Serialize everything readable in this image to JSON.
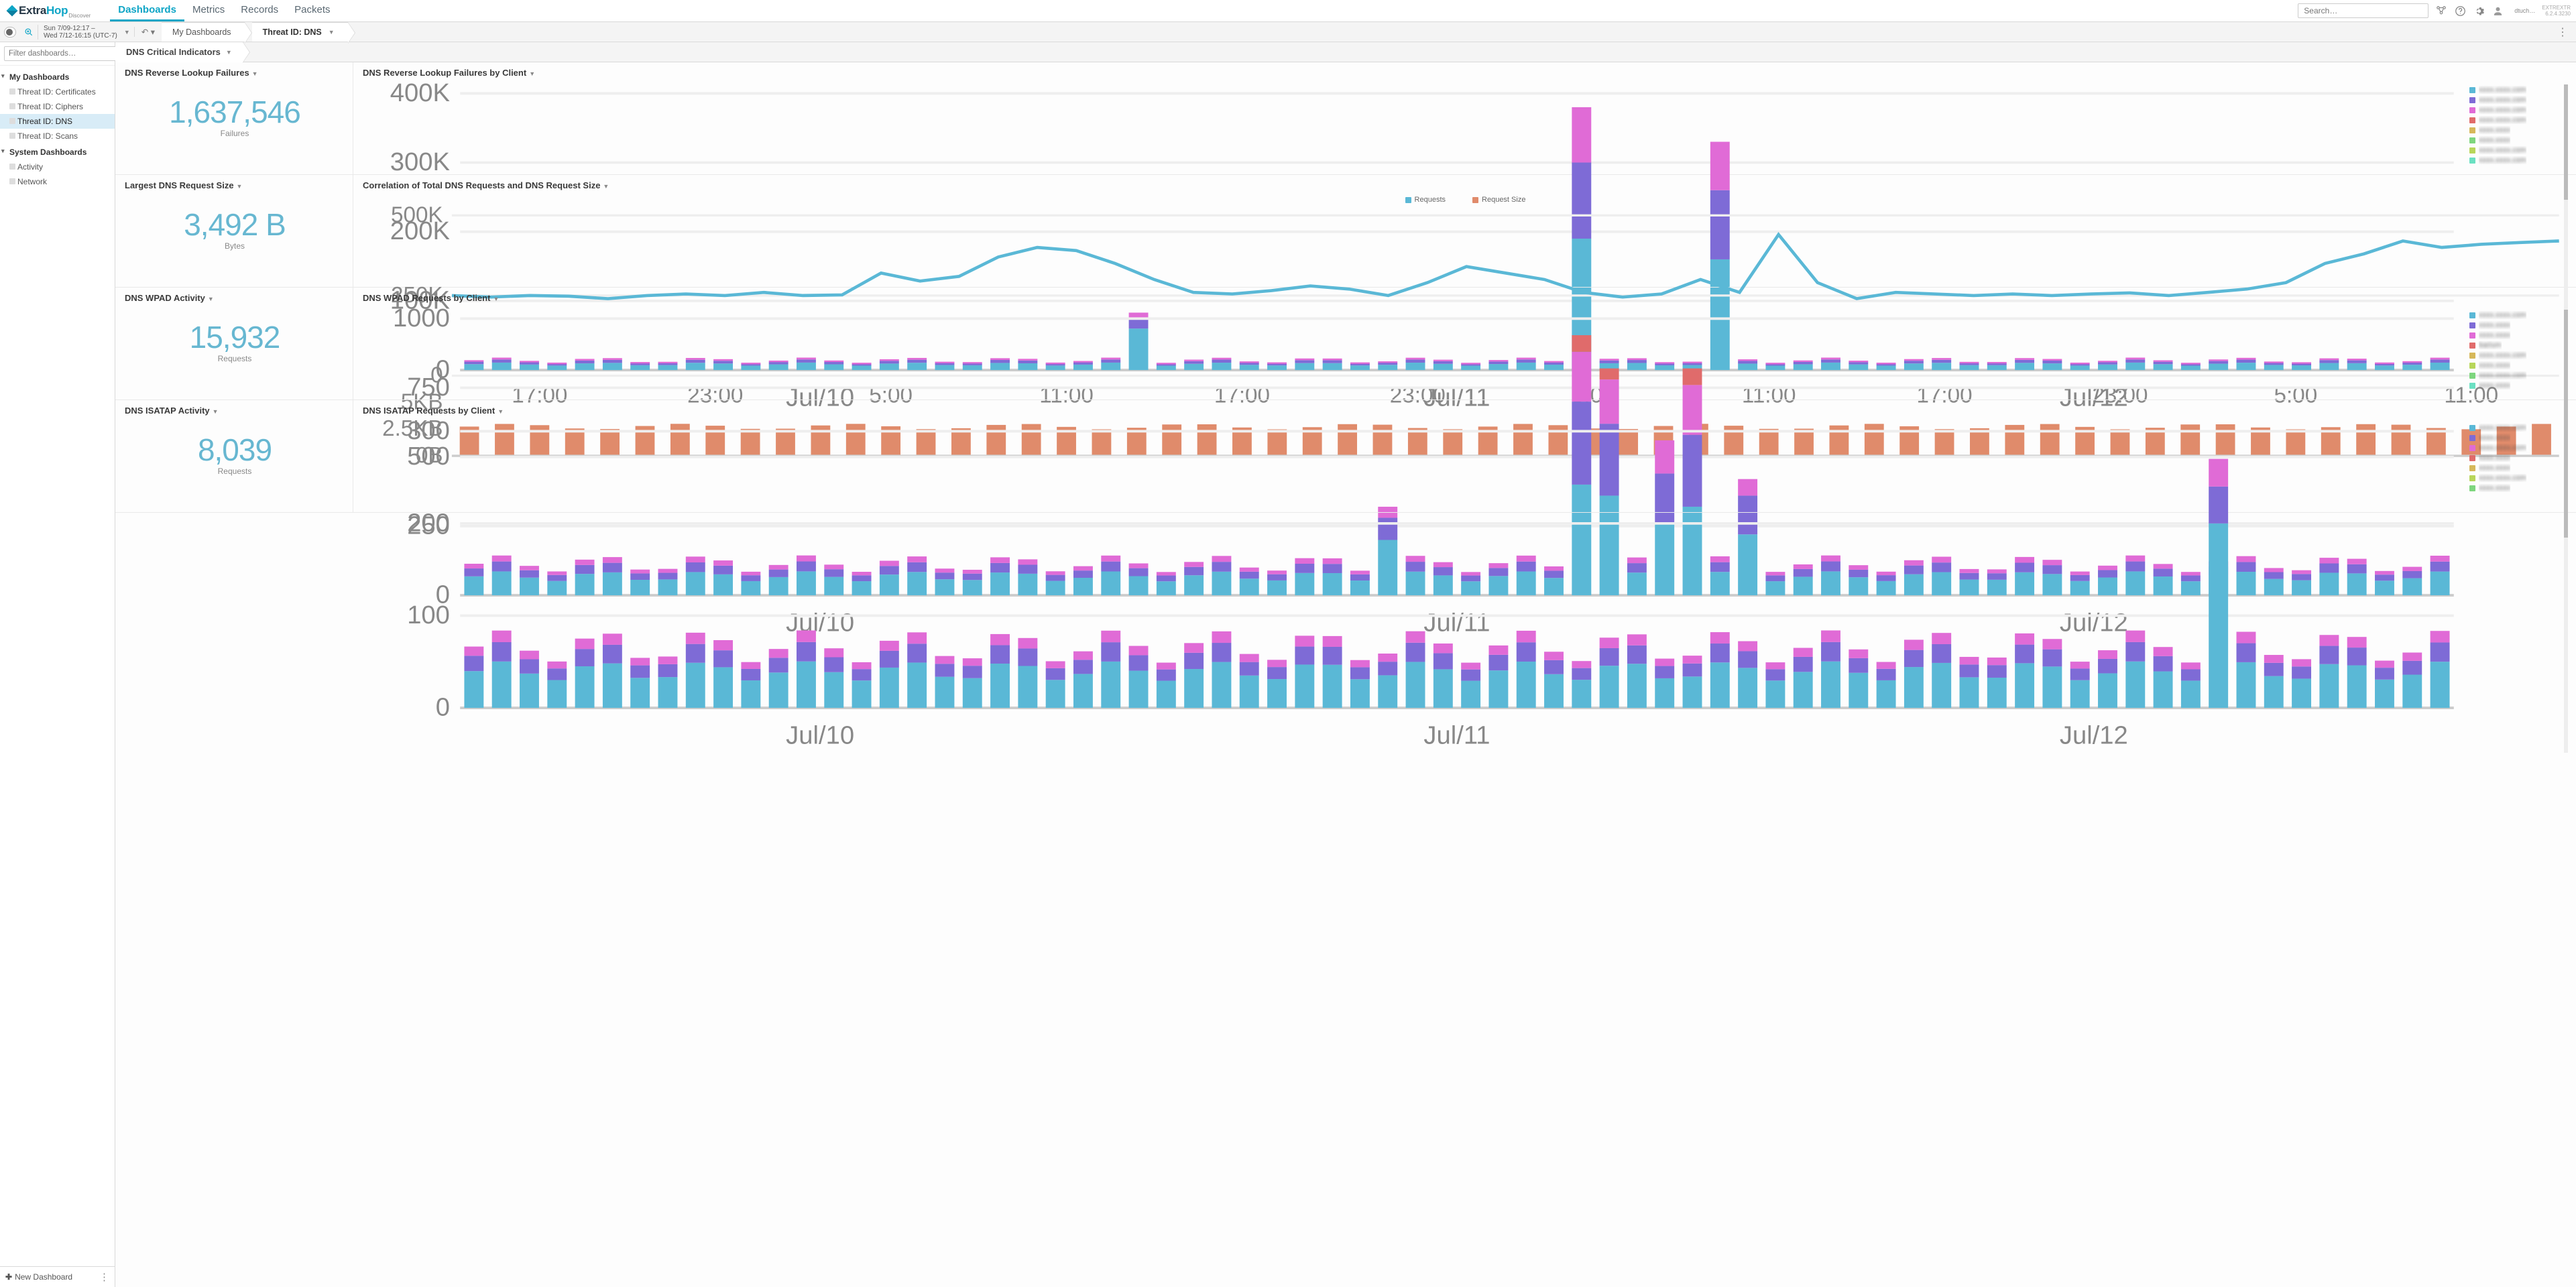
{
  "header": {
    "brand_prefix": "Extra",
    "brand_suffix": "Hop",
    "brand_sub": "Discover",
    "nav": [
      "Dashboards",
      "Metrics",
      "Records",
      "Packets"
    ],
    "nav_active": 0,
    "search_placeholder": "Search…",
    "username": "dtuch…",
    "product": "EXTREXTR",
    "version": "6.2.4.3230"
  },
  "secbar": {
    "time_line1": "Sun 7/09-12:17 –",
    "time_line2": "Wed 7/12-16:15 (UTC-7)",
    "crumb1": "My Dashboards",
    "crumb2": "Threat ID: DNS"
  },
  "sidebar": {
    "filter_placeholder": "Filter dashboards…",
    "groups": [
      {
        "label": "My Dashboards",
        "items": [
          "Threat ID: Certificates",
          "Threat ID: Ciphers",
          "Threat ID: DNS",
          "Threat ID: Scans"
        ],
        "active_index": 2
      },
      {
        "label": "System Dashboards",
        "items": [
          "Activity",
          "Network"
        ],
        "active_index": -1
      }
    ],
    "new_dashboard": "New Dashboard"
  },
  "region_title": "DNS Critical Indicators",
  "stats": [
    {
      "title": "DNS Reverse Lookup Failures",
      "value": "1,637,546",
      "unit": "Failures"
    },
    {
      "title": "Largest DNS Request Size",
      "value": "3,492 B",
      "unit": "Bytes"
    },
    {
      "title": "DNS WPAD Activity",
      "value": "15,932",
      "unit": "Requests"
    },
    {
      "title": "DNS ISATAP Activity",
      "value": "8,039",
      "unit": "Requests"
    }
  ],
  "charts": {
    "reverse_lookup": {
      "title": "DNS Reverse Lookup Failures by Client",
      "legend": [
        "xxxx.xxxx.com",
        "xxxx.xxxx.com",
        "xxxx.xxxx.com",
        "xxxx.xxxx.com",
        "xxxx.xxxx",
        "xxxx.xxxx",
        "xxxx.xxxx.com",
        "xxxx.xxxx.com"
      ]
    },
    "correlation": {
      "title": "Correlation of Total DNS Requests and DNS Request Size",
      "legend": [
        "Requests",
        "Request Size"
      ]
    },
    "wpad": {
      "title": "DNS WPAD Requests by Client",
      "legend": [
        "xxxx.xxxx.com",
        "xxxx.xxxx",
        "xxxx.xxxx",
        "barium",
        "xxxx.xxxx.com",
        "xxxx.xxxx",
        "xxxx.xxxx.com",
        "xxxx.xxxx"
      ]
    },
    "isatap": {
      "title": "DNS ISATAP Requests by Client",
      "legend": [
        "xxxx.xxxx.com",
        "xxxx.xxxx",
        "xxxx.xxxx.com",
        "xxxx.xxxx",
        "xxxx.xxxx",
        "xxxx.xxxx.com",
        "xxxx.xxxx"
      ]
    }
  },
  "chart_data": [
    {
      "id": "reverse_lookup",
      "type": "bar",
      "stacked": true,
      "title": "DNS Reverse Lookup Failures by Client",
      "ylabel": "",
      "ylim": [
        0,
        400000
      ],
      "yticks": [
        0,
        100000,
        200000,
        300000,
        400000
      ],
      "ytick_labels": [
        "0",
        "100K",
        "200K",
        "300K",
        "400K"
      ],
      "x_major": [
        "Jul/10",
        "Jul/11",
        "Jul/12"
      ],
      "n_bars": 72,
      "colors": [
        "#5ab8d6",
        "#7e6bd6",
        "#e06bd6",
        "#e06b6b",
        "#d6b85a",
        "#7ed67e",
        "#b8d65a",
        "#6be0c2"
      ],
      "baseline": 15000,
      "spikes": [
        {
          "i": 24,
          "stack": [
            60000,
            15000,
            8000
          ]
        },
        {
          "i": 40,
          "stack": [
            190000,
            110000,
            80000
          ]
        },
        {
          "i": 45,
          "stack": [
            160000,
            100000,
            70000
          ]
        }
      ]
    },
    {
      "id": "correlation",
      "type": "line+bar",
      "title": "Correlation of Total DNS Requests and DNS Request Size",
      "top_ylim": [
        0,
        500000
      ],
      "top_yticks": [
        0,
        250000,
        500000
      ],
      "top_ytick_labels": [
        "0",
        "250K",
        "500K"
      ],
      "bottom_ylim": [
        0,
        5120
      ],
      "bottom_yticks": [
        0,
        2560,
        5120
      ],
      "bottom_ytick_labels": [
        "0B",
        "2.5KB",
        "5KB"
      ],
      "xticks": [
        "17:00",
        "23:00",
        "5:00",
        "11:00",
        "17:00",
        "23:00",
        "5:00",
        "11:00",
        "17:00",
        "23:00",
        "5:00",
        "11:00"
      ],
      "line_color": "#5ab8d6",
      "bar_color": "#e08b6b",
      "line": [
        250,
        245,
        250,
        248,
        240,
        250,
        255,
        250,
        260,
        250,
        252,
        320,
        295,
        310,
        370,
        400,
        390,
        350,
        300,
        260,
        255,
        265,
        280,
        270,
        250,
        290,
        340,
        320,
        300,
        260,
        245,
        255,
        300,
        260,
        440,
        290,
        240,
        260,
        255,
        250,
        255,
        250,
        255,
        258,
        250,
        260,
        270,
        290,
        350,
        380,
        420,
        400,
        410,
        415,
        420
      ],
      "bar": 3300
    },
    {
      "id": "wpad",
      "type": "bar",
      "stacked": true,
      "title": "DNS WPAD Requests by Client",
      "ylim": [
        0,
        1000
      ],
      "yticks": [
        0,
        250,
        500,
        750,
        1000
      ],
      "ytick_labels": [
        "0",
        "250",
        "500",
        "750",
        "1000"
      ],
      "x_major": [
        "Jul/10",
        "Jul/11",
        "Jul/12"
      ],
      "n_bars": 72,
      "colors": [
        "#5ab8d6",
        "#7e6bd6",
        "#e06bd6",
        "#e06b6b",
        "#d6b85a",
        "#b8d65a",
        "#7ed67e",
        "#6be0c2"
      ],
      "baseline": 120,
      "spikes": [
        {
          "i": 33,
          "stack": [
            200,
            80,
            40
          ]
        },
        {
          "i": 40,
          "stack": [
            400,
            300,
            180,
            60
          ]
        },
        {
          "i": 41,
          "stack": [
            360,
            260,
            160,
            40
          ]
        },
        {
          "i": 43,
          "stack": [
            260,
            180,
            120
          ]
        },
        {
          "i": 44,
          "stack": [
            320,
            260,
            180,
            60
          ]
        },
        {
          "i": 46,
          "stack": [
            220,
            140,
            60
          ]
        }
      ]
    },
    {
      "id": "isatap",
      "type": "bar",
      "stacked": true,
      "title": "DNS ISATAP Requests by Client",
      "ylim": [
        0,
        300
      ],
      "yticks": [
        0,
        100,
        200,
        300
      ],
      "ytick_labels": [
        "0",
        "100",
        "200",
        "300"
      ],
      "x_major": [
        "Jul/10",
        "Jul/11",
        "Jul/12"
      ],
      "n_bars": 72,
      "colors": [
        "#5ab8d6",
        "#7e6bd6",
        "#e06bd6",
        "#e06b6b",
        "#d6b85a",
        "#b8d65a",
        "#7ed67e"
      ],
      "baseline": 70,
      "spikes": [
        {
          "i": 63,
          "stack": [
            200,
            40,
            30
          ]
        }
      ]
    }
  ]
}
